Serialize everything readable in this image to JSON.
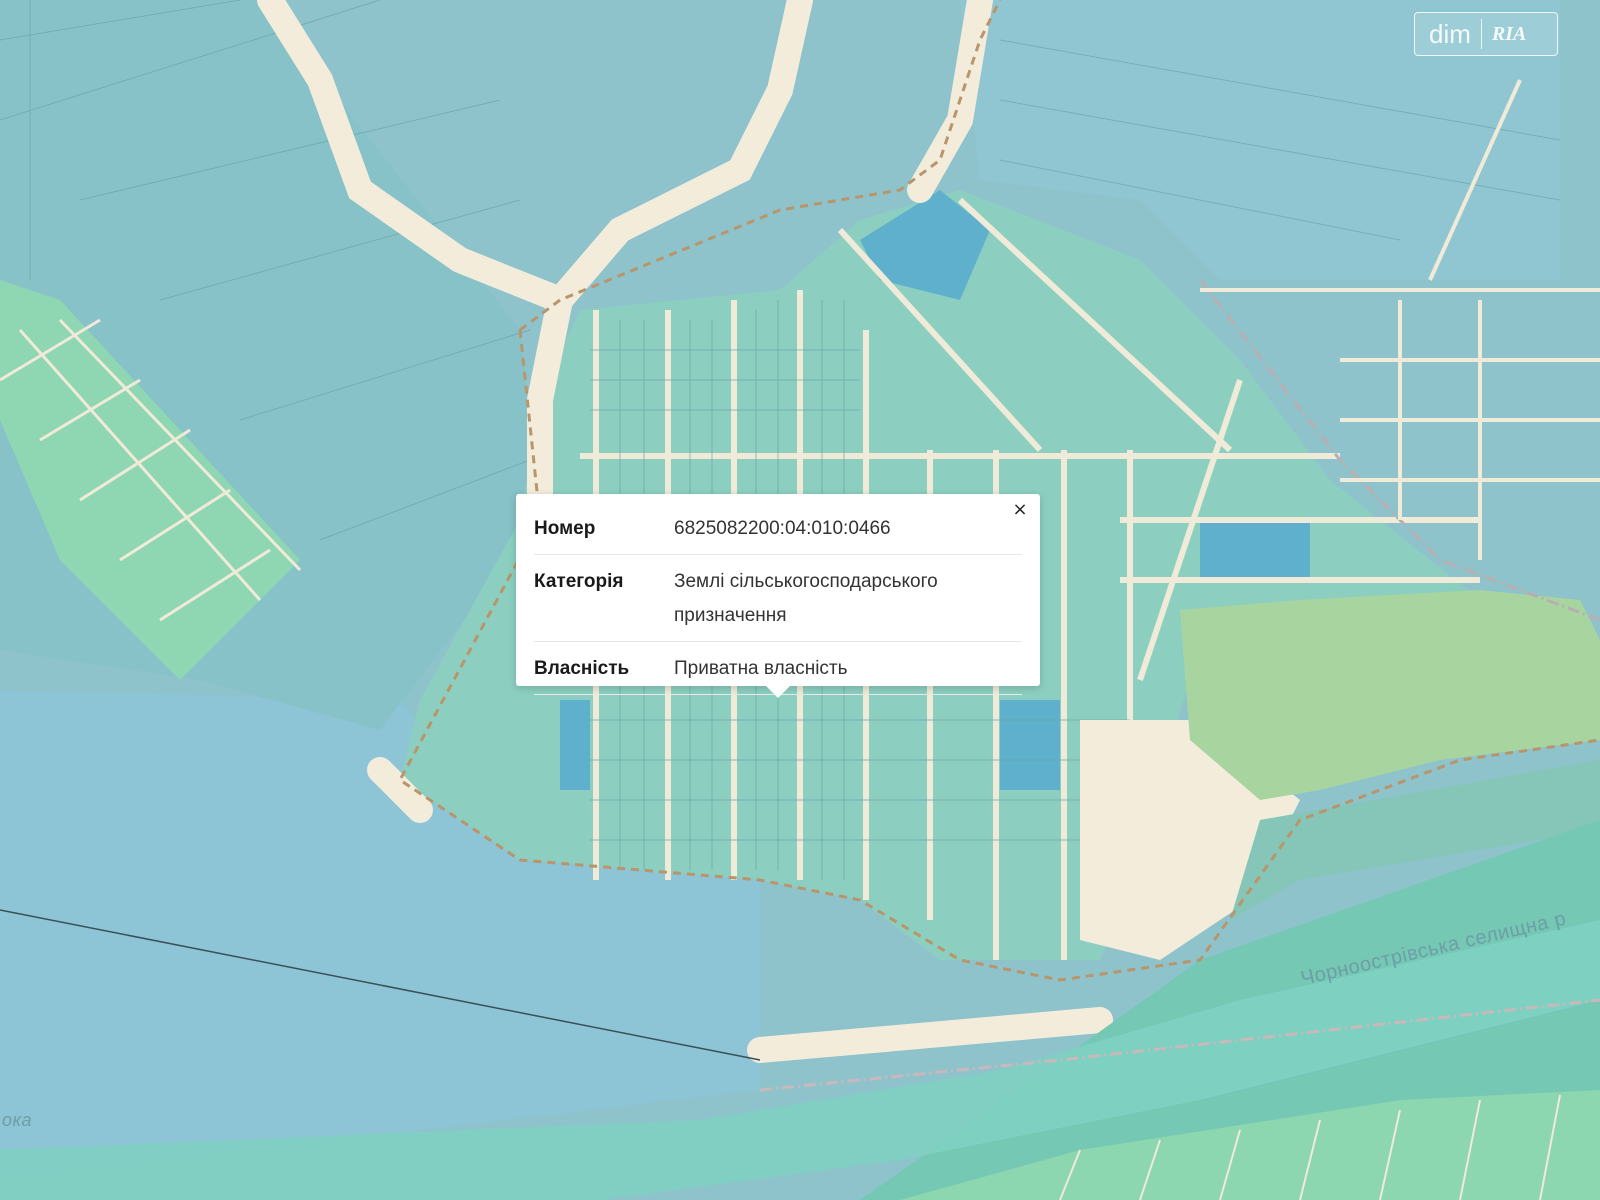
{
  "popup": {
    "close_label": "×",
    "rows": [
      {
        "label": "Номер",
        "value": "6825082200:04:010:0466"
      },
      {
        "label": "Категорія",
        "value": "Землі сільськогосподарського призначення"
      },
      {
        "label": "Власність",
        "value": "Приватна власність"
      }
    ]
  },
  "logo": {
    "part1": "dim",
    "part2": "RIA"
  },
  "map_labels": {
    "council": "Чорноострівська селищна р",
    "river": "ока"
  },
  "colors": {
    "water": "#8ec3cc",
    "parcel_teal": "#86c6c6",
    "parcel_green": "#8cd8b0",
    "parcel_blue": "#5fb0cc",
    "road": "#f0ead8",
    "forest": "#a8d4a0",
    "boundary": "#b8956a",
    "river_band": "#74c8b4"
  }
}
